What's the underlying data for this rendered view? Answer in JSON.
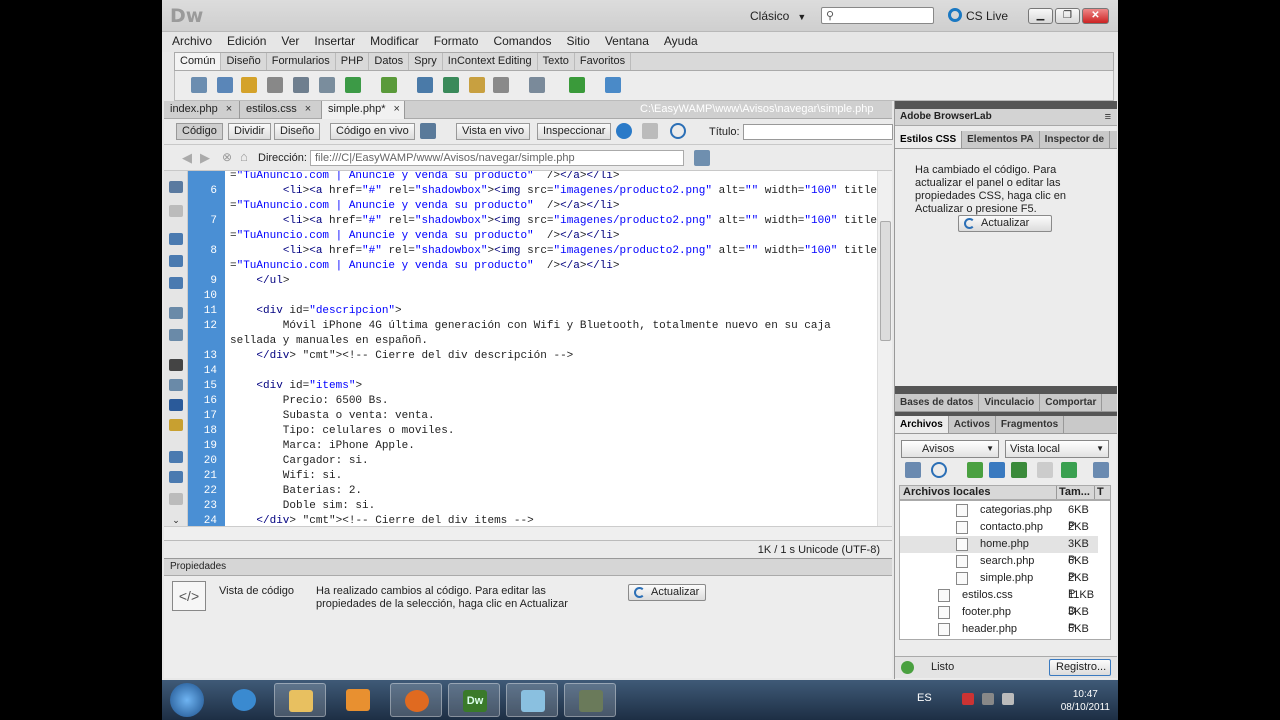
{
  "app": {
    "logo": "Dw",
    "workspace": "Clásico",
    "cs_live": "CS Live"
  },
  "menu": [
    "Archivo",
    "Edición",
    "Ver",
    "Insertar",
    "Modificar",
    "Formato",
    "Comandos",
    "Sitio",
    "Ventana",
    "Ayuda"
  ],
  "insert_tabs": [
    "Común",
    "Diseño",
    "Formularios",
    "PHP",
    "Datos",
    "Spry",
    "InContext Editing",
    "Texto",
    "Favoritos"
  ],
  "doc_tabs": [
    {
      "label": "index.php",
      "close": "×"
    },
    {
      "label": "estilos.css",
      "close": "×"
    },
    {
      "label": "simple.php*",
      "close": "×"
    }
  ],
  "doc_path": "C:\\EasyWAMP\\www\\Avisos\\navegar\\simple.php",
  "view_buttons": {
    "code": "Código",
    "split": "Dividir",
    "design": "Diseño",
    "live_code": "Código en vivo",
    "live_view": "Vista en vivo",
    "inspect": "Inspeccionar",
    "title_label": "Título:"
  },
  "address": {
    "label": "Dirección:",
    "value": "file:///C|/EasyWAMP/www/Avisos/navegar/simple.php"
  },
  "code": {
    "lines": [
      {
        "num": "",
        "text": "=\"TuAnuncio.com | Anuncie y venda su producto\"  /></a></li>"
      },
      {
        "num": "6",
        "text": "        <li><a href=\"#\" rel=\"shadowbox\"><img src=\"imagenes/producto2.png\" alt=\"\" width=\"100\" title"
      },
      {
        "num": "",
        "text": "=\"TuAnuncio.com | Anuncie y venda su producto\"  /></a></li>"
      },
      {
        "num": "7",
        "text": "        <li><a href=\"#\" rel=\"shadowbox\"><img src=\"imagenes/producto2.png\" alt=\"\" width=\"100\" title"
      },
      {
        "num": "",
        "text": "=\"TuAnuncio.com | Anuncie y venda su producto\"  /></a></li>"
      },
      {
        "num": "8",
        "text": "        <li><a href=\"#\" rel=\"shadowbox\"><img src=\"imagenes/producto2.png\" alt=\"\" width=\"100\" title"
      },
      {
        "num": "",
        "text": "=\"TuAnuncio.com | Anuncie y venda su producto\"  /></a></li>"
      },
      {
        "num": "9",
        "text": "    </ul>"
      },
      {
        "num": "10",
        "text": ""
      },
      {
        "num": "11",
        "text": "    <div id=\"descripcion\">"
      },
      {
        "num": "12",
        "text": "        Móvil iPhone 4G última generación con Wifi y Bluetooth, totalmente nuevo en su caja"
      },
      {
        "num": "",
        "text": "sellada y manuales en españoñ."
      },
      {
        "num": "13",
        "text": "    </div> <!-- Cierre del div descripción -->"
      },
      {
        "num": "14",
        "text": ""
      },
      {
        "num": "15",
        "text": "    <div id=\"items\">"
      },
      {
        "num": "16",
        "text": "        Precio: 6500 Bs."
      },
      {
        "num": "17",
        "text": "        Subasta o venta: venta."
      },
      {
        "num": "18",
        "text": "        Tipo: celulares o moviles."
      },
      {
        "num": "19",
        "text": "        Marca: iPhone Apple."
      },
      {
        "num": "20",
        "text": "        Cargador: si."
      },
      {
        "num": "21",
        "text": "        Wifi: si."
      },
      {
        "num": "22",
        "text": "        Baterias: 2."
      },
      {
        "num": "23",
        "text": "        Doble sim: si."
      },
      {
        "num": "24",
        "text": "    </div> <!-- Cierre del div items -->"
      }
    ]
  },
  "status": {
    "info": "1K / 1 s  Unicode (UTF-8)"
  },
  "properties": {
    "title": "Propiedades",
    "label": "Vista de código",
    "message": "Ha realizado cambios al código. Para editar las propiedades de la selección, haga clic en Actualizar",
    "button": "Actualizar"
  },
  "right_panel": {
    "browserlab": "Adobe BrowserLab",
    "css_tabs": [
      "Estilos CSS",
      "Elementos PA",
      "Inspector de"
    ],
    "css_message": "Ha cambiado el código. Para actualizar el panel o editar las propiedades CSS, haga clic en Actualizar o presione F5.",
    "css_button": "Actualizar",
    "db_tabs": [
      "Bases de datos",
      "Vinculacio",
      "Comportar"
    ],
    "file_tabs": [
      "Archivos",
      "Activos",
      "Fragmentos"
    ],
    "site_select": "Avisos",
    "view_select": "Vista local",
    "file_header": {
      "name": "Archivos locales",
      "size": "Tam...",
      "type": "T"
    },
    "files": [
      {
        "name": "categorias.php",
        "size": "6KB P",
        "level": 2
      },
      {
        "name": "contacto.php",
        "size": "2KB P",
        "level": 2
      },
      {
        "name": "home.php",
        "size": "3KB P",
        "level": 2,
        "selected": true
      },
      {
        "name": "search.php",
        "size": "6KB P",
        "level": 2
      },
      {
        "name": "simple.php",
        "size": "2KB P",
        "level": 2
      },
      {
        "name": "estilos.css",
        "size": "11KB D",
        "level": 1
      },
      {
        "name": "footer.php",
        "size": "3KB P",
        "level": 1
      },
      {
        "name": "header.php",
        "size": "5KB P",
        "level": 1
      }
    ],
    "status_text": "Listo",
    "log_button": "Registro..."
  },
  "taskbar": {
    "lang": "ES",
    "time": "10:47",
    "date": "08/10/2011",
    "apps": [
      "Internet Explorer",
      "Explorer",
      "Media Player",
      "Firefox",
      "Dreamweaver",
      "App",
      "App"
    ]
  }
}
